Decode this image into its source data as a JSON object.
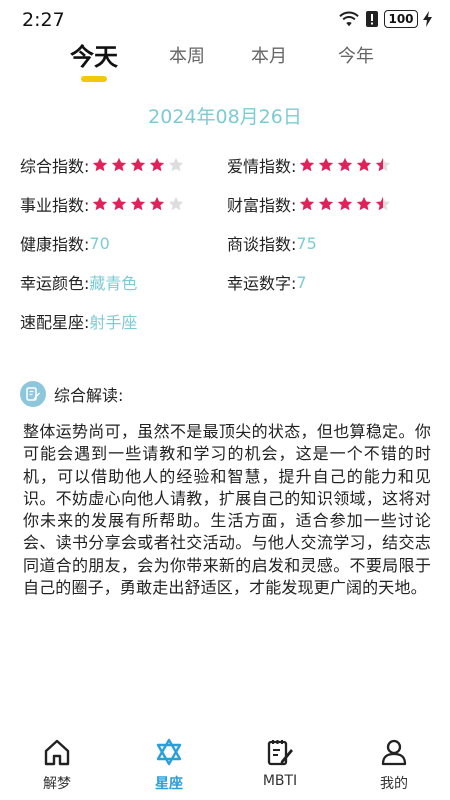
{
  "status_bar": {
    "time": "2:27",
    "battery": "100"
  },
  "tabs": [
    {
      "label": "今天",
      "active": true
    },
    {
      "label": "本周",
      "active": false
    },
    {
      "label": "本月",
      "active": false
    },
    {
      "label": "今年",
      "active": false
    }
  ],
  "date": "2024年08月26日",
  "indices": {
    "overall": {
      "label": "综合指数:",
      "stars": 4
    },
    "love": {
      "label": "爱情指数:",
      "stars": 4.5
    },
    "career": {
      "label": "事业指数:",
      "stars": 4
    },
    "wealth": {
      "label": "财富指数:",
      "stars": 4.5
    },
    "health": {
      "label": "健康指数:",
      "value": "70"
    },
    "negotiation": {
      "label": "商谈指数:",
      "value": "75"
    },
    "lucky_color": {
      "label": "幸运颜色:",
      "value": "藏青色"
    },
    "lucky_number": {
      "label": "幸运数字:",
      "value": "7"
    },
    "match_sign": {
      "label": "速配星座:",
      "value": "射手座"
    }
  },
  "analysis": {
    "title": "综合解读:",
    "text": "整体运势尚可，虽然不是最顶尖的状态，但也算稳定。你可能会遇到一些请教和学习的机会，这是一个不错的时机，可以借助他人的经验和智慧，提升自己的能力和见识。不妨虚心向他人请教，扩展自己的知识领域，这将对你未来的发展有所帮助。生活方面，适合参加一些讨论会、读书分享会或者社交活动。与他人交流学习，结交志同道合的朋友，会为你带来新的启发和灵感。不要局限于自己的圈子，勇敢走出舒适区，才能发现更广阔的天地。"
  },
  "bottom_nav": [
    {
      "label": "解梦",
      "icon": "home-icon",
      "active": false
    },
    {
      "label": "星座",
      "icon": "star-of-david-icon",
      "active": true
    },
    {
      "label": "MBTI",
      "icon": "notepad-pencil-icon",
      "active": false
    },
    {
      "label": "我的",
      "icon": "user-icon",
      "active": false
    }
  ],
  "colors": {
    "accent": "#7ecbd3",
    "star_filled": "#e0215a",
    "star_empty": "#dddddd",
    "tab_underline": "#f2c90a",
    "nav_active": "#2a9fd8"
  }
}
